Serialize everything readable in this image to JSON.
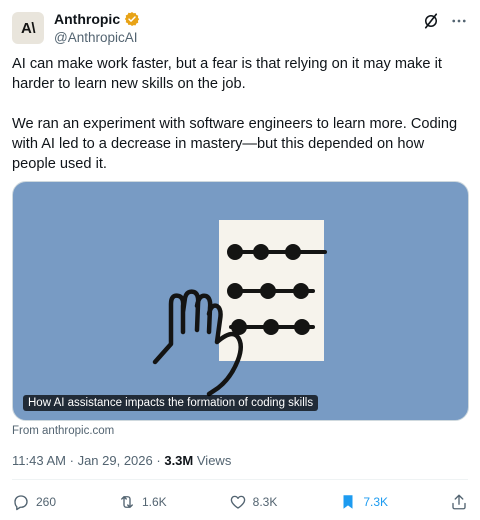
{
  "author": {
    "avatar_text": "A\\",
    "display_name": "Anthropic",
    "handle": "@AnthropicAI",
    "verified_color": "#e8a317"
  },
  "post": {
    "paragraphs": [
      "AI can make work faster, but a fear is that relying on it may make it harder to learn new skills on the job.",
      "We ran an experiment with software engineers to learn more. Coding with AI led to a decrease in mastery—but this depended on how people used it."
    ]
  },
  "media": {
    "caption": "How AI assistance impacts the formation of coding skills",
    "background_color": "#789bc4",
    "source": "From anthropic.com"
  },
  "meta": {
    "time": "11:43 AM",
    "separator": "·",
    "date": "Jan 29, 2026",
    "views_count": "3.3M",
    "views_label": "Views"
  },
  "actions": {
    "replies": "260",
    "reposts": "1.6K",
    "likes": "8.3K",
    "bookmarks": "7.3K",
    "bookmark_color": "#1d9bf0"
  },
  "icons": {
    "header": [
      "grok-icon",
      "more-icon"
    ],
    "actions": [
      "reply-icon",
      "repost-icon",
      "like-icon",
      "bookmark-icon",
      "share-icon"
    ]
  }
}
